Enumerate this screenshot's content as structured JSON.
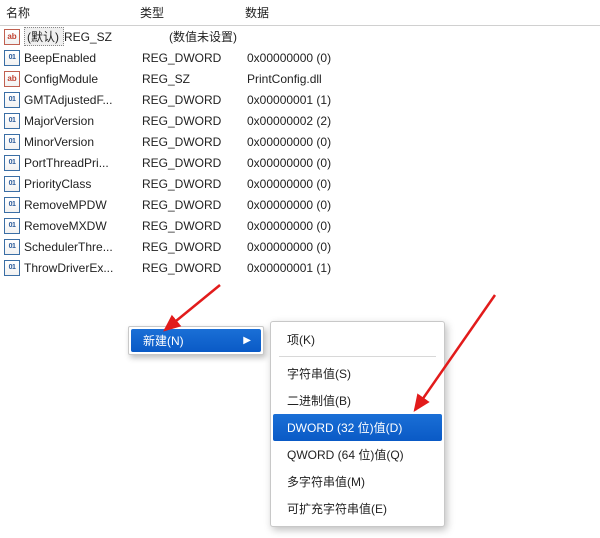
{
  "columns": {
    "name": "名称",
    "type": "类型",
    "data": "数据"
  },
  "entries": [
    {
      "icon": "sz",
      "name": "(默认)",
      "selected": true,
      "type": "REG_SZ",
      "data": "(数值未设置)"
    },
    {
      "icon": "dw",
      "name": "BeepEnabled",
      "type": "REG_DWORD",
      "data": "0x00000000 (0)"
    },
    {
      "icon": "sz",
      "name": "ConfigModule",
      "type": "REG_SZ",
      "data": "PrintConfig.dll"
    },
    {
      "icon": "dw",
      "name": "GMTAdjustedF...",
      "type": "REG_DWORD",
      "data": "0x00000001 (1)"
    },
    {
      "icon": "dw",
      "name": "MajorVersion",
      "type": "REG_DWORD",
      "data": "0x00000002 (2)"
    },
    {
      "icon": "dw",
      "name": "MinorVersion",
      "type": "REG_DWORD",
      "data": "0x00000000 (0)"
    },
    {
      "icon": "dw",
      "name": "PortThreadPri...",
      "type": "REG_DWORD",
      "data": "0x00000000 (0)"
    },
    {
      "icon": "dw",
      "name": "PriorityClass",
      "type": "REG_DWORD",
      "data": "0x00000000 (0)"
    },
    {
      "icon": "dw",
      "name": "RemoveMPDW",
      "type": "REG_DWORD",
      "data": "0x00000000 (0)"
    },
    {
      "icon": "dw",
      "name": "RemoveMXDW",
      "type": "REG_DWORD",
      "data": "0x00000000 (0)"
    },
    {
      "icon": "dw",
      "name": "SchedulerThre...",
      "type": "REG_DWORD",
      "data": "0x00000000 (0)"
    },
    {
      "icon": "dw",
      "name": "ThrowDriverEx...",
      "type": "REG_DWORD",
      "data": "0x00000001 (1)"
    }
  ],
  "menu": {
    "primary": {
      "label": "新建(N)"
    },
    "secondary": [
      {
        "label": "项(K)",
        "kind": "item"
      },
      {
        "kind": "sep"
      },
      {
        "label": "字符串值(S)",
        "kind": "item"
      },
      {
        "label": "二进制值(B)",
        "kind": "item"
      },
      {
        "label": "DWORD (32 位)值(D)",
        "kind": "item",
        "selected": true
      },
      {
        "label": "QWORD (64 位)值(Q)",
        "kind": "item"
      },
      {
        "label": "多字符串值(M)",
        "kind": "item"
      },
      {
        "label": "可扩充字符串值(E)",
        "kind": "item"
      }
    ]
  }
}
